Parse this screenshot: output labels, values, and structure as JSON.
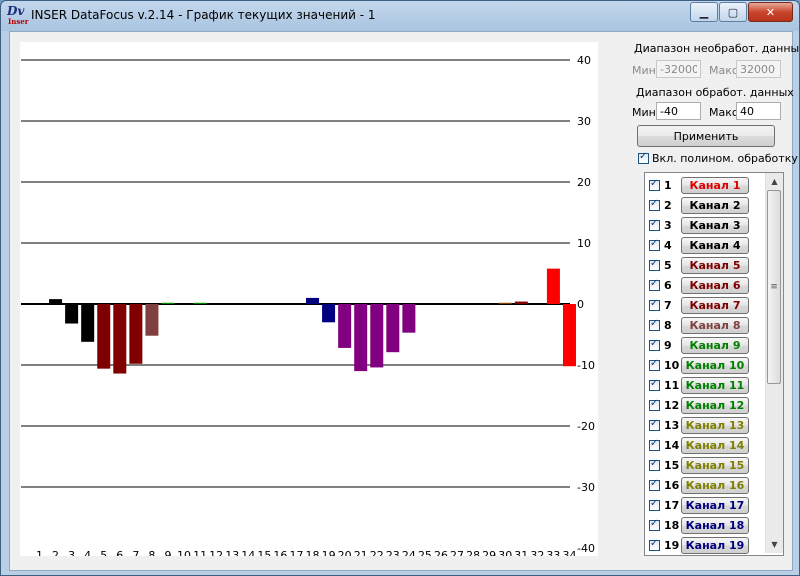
{
  "window": {
    "title": "INSER DataFocus v.2.14 - График текущих значений - 1",
    "icon_text": "Dv",
    "icon_subtext": "Inser",
    "controls": {
      "minimize": "▁",
      "maximize": "▢",
      "close": "✕"
    }
  },
  "raw_range": {
    "heading": "Диапазон необработ. данных",
    "min_label": "Мин",
    "min_value": "-32000",
    "max_label": "Макс",
    "max_value": "32000"
  },
  "proc_range": {
    "heading": "Диапазон обработ. данных",
    "min_label": "Мин",
    "min_value": "-40",
    "max_label": "Макс",
    "max_value": "40"
  },
  "apply_label": "Применить",
  "poly_label": "Вкл. полином. обработку",
  "scroll_glyphs": {
    "up": "▲",
    "down": "▼",
    "grip": "≡"
  },
  "channels": [
    {
      "num": "1",
      "label": "Канал 1",
      "color": "#e00000"
    },
    {
      "num": "2",
      "label": "Канал 2",
      "color": "#000000"
    },
    {
      "num": "3",
      "label": "Канал 3",
      "color": "#000000"
    },
    {
      "num": "4",
      "label": "Канал 4",
      "color": "#000000"
    },
    {
      "num": "5",
      "label": "Канал 5",
      "color": "#800000"
    },
    {
      "num": "6",
      "label": "Канал 6",
      "color": "#800000"
    },
    {
      "num": "7",
      "label": "Канал 7",
      "color": "#800000"
    },
    {
      "num": "8",
      "label": "Канал 8",
      "color": "#804040"
    },
    {
      "num": "9",
      "label": "Канал 9",
      "color": "#008000"
    },
    {
      "num": "10",
      "label": "Канал 10",
      "color": "#008000"
    },
    {
      "num": "11",
      "label": "Канал 11",
      "color": "#008000"
    },
    {
      "num": "12",
      "label": "Канал 12",
      "color": "#008000"
    },
    {
      "num": "13",
      "label": "Канал 13",
      "color": "#808000"
    },
    {
      "num": "14",
      "label": "Канал 14",
      "color": "#808000"
    },
    {
      "num": "15",
      "label": "Канал 15",
      "color": "#808000"
    },
    {
      "num": "16",
      "label": "Канал 16",
      "color": "#808000"
    },
    {
      "num": "17",
      "label": "Канал 17",
      "color": "#000080"
    },
    {
      "num": "18",
      "label": "Канал 18",
      "color": "#000080"
    },
    {
      "num": "19",
      "label": "Канал 19",
      "color": "#000080"
    }
  ],
  "chart_data": {
    "type": "bar",
    "ylim": [
      -40,
      40
    ],
    "yticks": [
      40,
      30,
      20,
      10,
      0,
      -10,
      -20,
      -30,
      -40
    ],
    "grid": true,
    "categories": [
      "1",
      "2",
      "3",
      "4",
      "5",
      "6",
      "7",
      "8",
      "9",
      "10",
      "11",
      "12",
      "13",
      "14",
      "15",
      "16",
      "17",
      "18",
      "19",
      "20",
      "21",
      "22",
      "23",
      "24",
      "25",
      "26",
      "27",
      "28",
      "29",
      "30",
      "31",
      "32",
      "33",
      "34"
    ],
    "values": [
      0,
      0.8,
      -3.2,
      -6.2,
      -10.6,
      -11.4,
      -9.8,
      -5.2,
      0.2,
      0,
      0.2,
      0,
      0,
      0,
      0,
      0,
      0,
      1.0,
      -3.0,
      -7.2,
      -11.0,
      -10.4,
      -7.9,
      -4.7,
      0,
      0,
      0,
      0,
      0,
      0.2,
      0.4,
      0,
      5.8,
      -10.2
    ],
    "colors": [
      "#ff0000",
      "#000000",
      "#000000",
      "#000000",
      "#800000",
      "#800000",
      "#800000",
      "#804040",
      "#008000",
      "#008000",
      "#008000",
      "#008000",
      "#808000",
      "#808000",
      "#808000",
      "#808000",
      "#000080",
      "#000080",
      "#000080",
      "#800080",
      "#800080",
      "#800080",
      "#800080",
      "#800080",
      "#008080",
      "#008080",
      "#008080",
      "#008080",
      "#804000",
      "#804000",
      "#800000",
      "#800000",
      "#ff0000",
      "#ff0000"
    ]
  }
}
